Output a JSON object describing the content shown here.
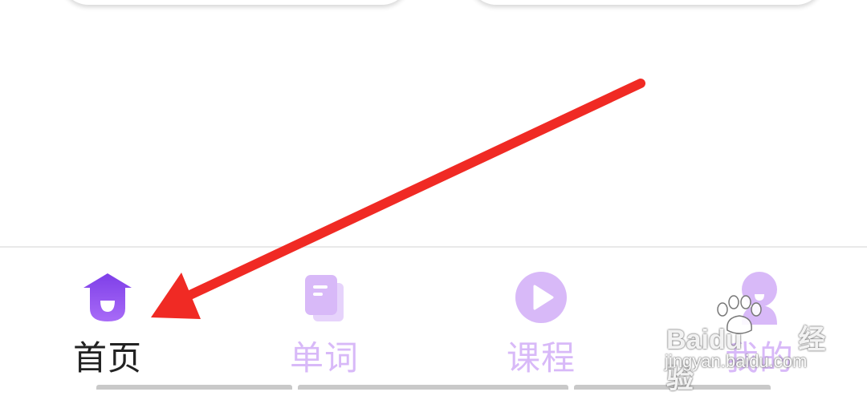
{
  "tabs": [
    {
      "label": "首页",
      "icon": "home-icon",
      "active": true
    },
    {
      "label": "单词",
      "icon": "word-book-icon",
      "active": false
    },
    {
      "label": "课程",
      "icon": "play-course-icon",
      "active": false
    },
    {
      "label": "我的",
      "icon": "profile-icon",
      "active": false
    }
  ],
  "watermark": {
    "brand": "Baidu",
    "brand_cn": "经验",
    "url": "jingyan.baidu.com"
  },
  "colors": {
    "active": "#8b4ff0",
    "inactive": "#d8b9f8",
    "annotation_arrow": "#f02a24"
  }
}
